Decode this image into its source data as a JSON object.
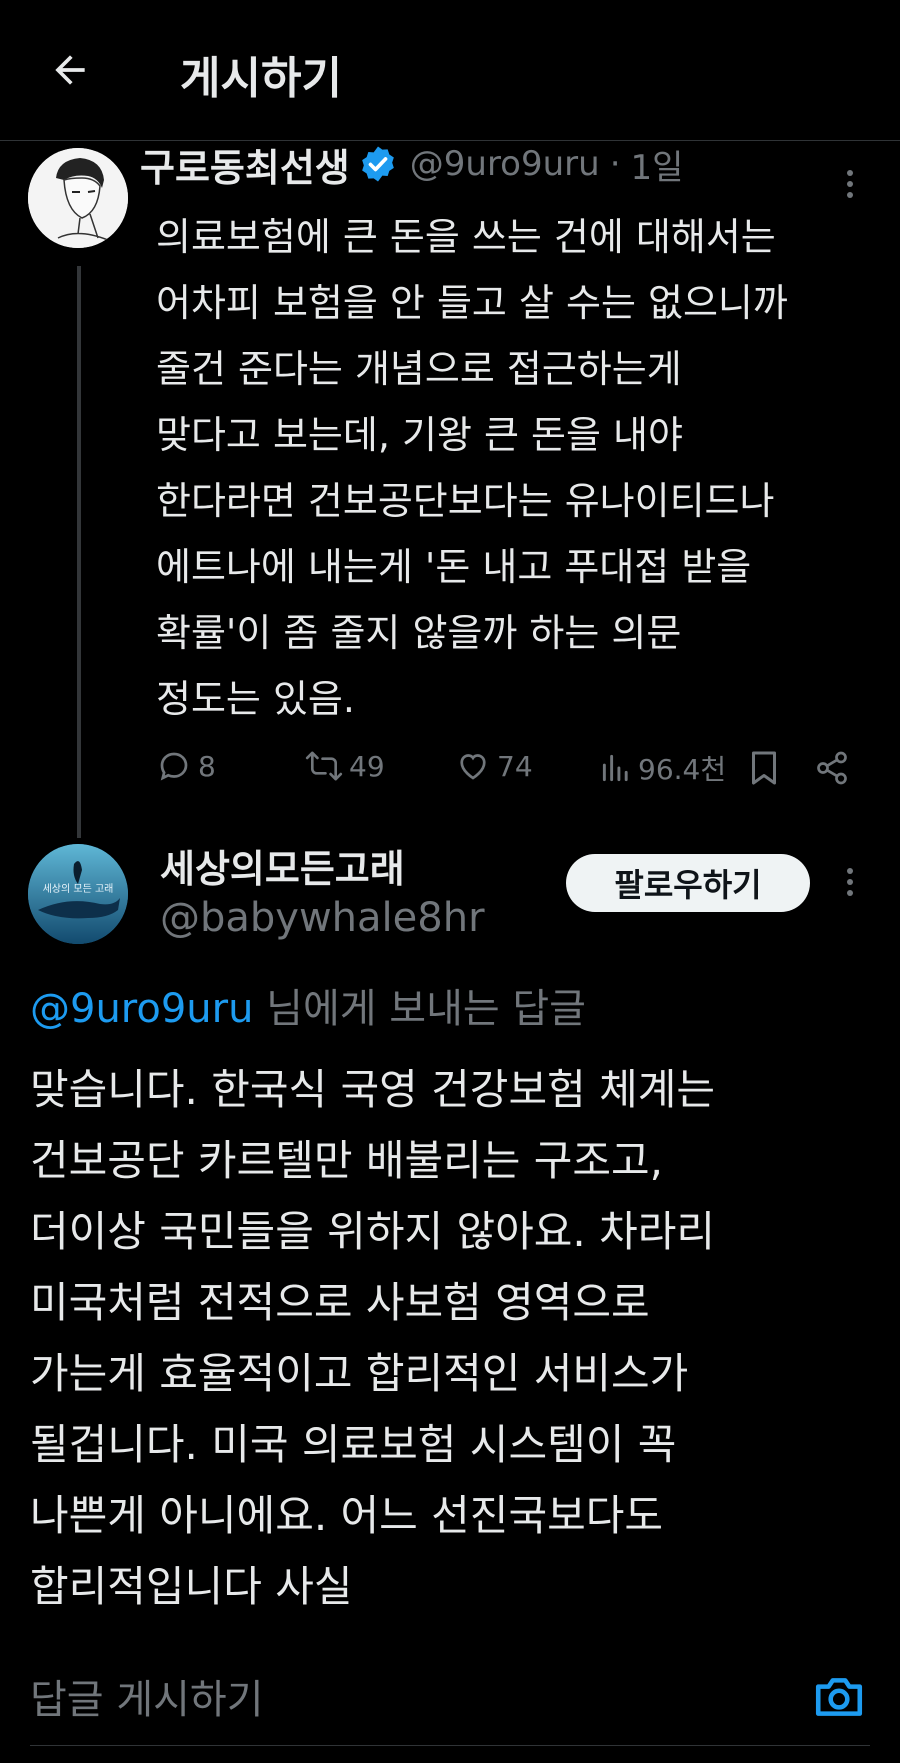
{
  "header": {
    "title": "게시하기"
  },
  "original_tweet": {
    "display_name": "구로동최선생",
    "handle": "@9uro9uru",
    "separator": "·",
    "time": "1일",
    "text": "의료보험에 큰 돈을 쓰는 건에 대해서는\n어차피 보험을 안 들고 살 수는 없으니까\n줄건 준다는 개념으로 접근하는게\n맞다고 보는데, 기왕 큰 돈을 내야\n한다라면 건보공단보다는 유나이티드나\n에트나에 내는게 '돈 내고 푸대접 받을\n확률'이 좀 줄지 않을까 하는 의문\n정도는 있음.",
    "stats": {
      "replies": "8",
      "retweets": "49",
      "likes": "74",
      "views": "96.4천"
    }
  },
  "reply": {
    "display_name": "세상의모든고래",
    "handle": "@babywhale8hr",
    "follow_label": "팔로우하기",
    "avatar_text": "세상의 모든 고래",
    "replying_to_handle": "@9uro9uru",
    "replying_to_suffix": "님에게 보내는 답글",
    "text": "맞습니다. 한국식 국영 건강보험 체계는\n건보공단 카르텔만 배불리는 구조고,\n더이상 국민들을 위하지 않아요. 차라리\n미국처럼 전적으로 사보험 영역으로\n가는게 효율적이고 합리적인 서비스가\n될겁니다. 미국 의료보험 시스템이 꼭\n나쁜게 아니에요. 어느 선진국보다도\n합리적입니다 사실"
  },
  "composer": {
    "placeholder": "답글 게시하기"
  },
  "colors": {
    "accent": "#1d9bf0",
    "background": "#000000",
    "muted": "#71767b",
    "text": "#e7e9ea"
  },
  "icons": [
    "back-arrow-icon",
    "verified-badge-icon",
    "more-icon",
    "reply-icon",
    "retweet-icon",
    "like-icon",
    "views-icon",
    "bookmark-icon",
    "share-icon",
    "camera-icon"
  ]
}
